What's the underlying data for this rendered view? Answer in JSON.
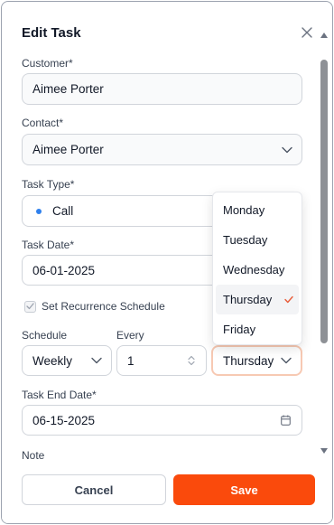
{
  "dialog": {
    "title": "Edit Task"
  },
  "customer": {
    "label": "Customer*",
    "value": "Aimee Porter"
  },
  "contact": {
    "label": "Contact*",
    "value": "Aimee Porter"
  },
  "task_type": {
    "label": "Task Type*",
    "value": "Call"
  },
  "task_date": {
    "label": "Task Date*",
    "value": "06-01-2025"
  },
  "recurrence": {
    "label": "Set Recurrence Schedule",
    "checked": true
  },
  "schedule": {
    "label": "Schedule",
    "value": "Weekly"
  },
  "every": {
    "label": "Every",
    "value": "1"
  },
  "day": {
    "value": "Thursday"
  },
  "day_options": [
    "Monday",
    "Tuesday",
    "Wednesday",
    "Thursday",
    "Friday"
  ],
  "selected_day": "Thursday",
  "task_end_date": {
    "label": "Task End Date*",
    "value": "06-15-2025"
  },
  "note": {
    "label": "Note"
  },
  "buttons": {
    "cancel": "Cancel",
    "save": "Save"
  },
  "colors": {
    "accent": "#fa4a0c",
    "dot": "#2f80ed",
    "check": "#e85d3a"
  }
}
